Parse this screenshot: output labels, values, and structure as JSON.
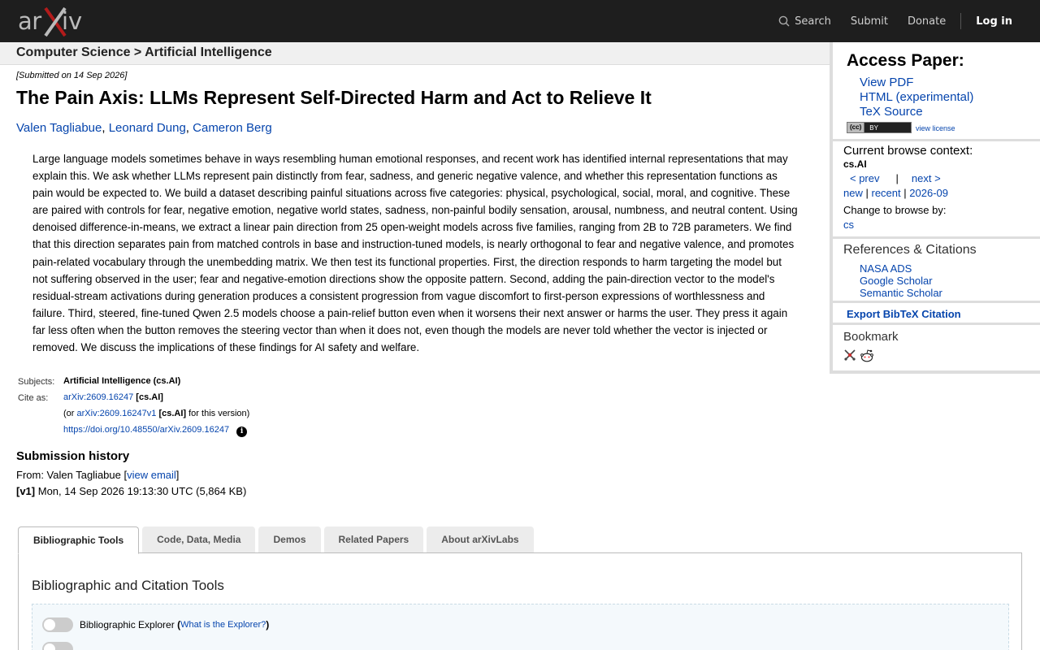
{
  "header": {
    "logo_text": "arXiv",
    "nav": {
      "search": "Search",
      "submit": "Submit",
      "donate": "Donate",
      "login": "Log in"
    }
  },
  "breadcrumb": "Computer Science > Artificial Intelligence",
  "paper": {
    "submitted": "[Submitted on 14 Sep 2026]",
    "title": "The Pain Axis: LLMs Represent Self-Directed Harm and Act to Relieve It",
    "authors": [
      "Valen Tagliabue",
      "Leonard Dung",
      "Cameron Berg"
    ],
    "abstract": "Large language models sometimes behave in ways resembling human emotional responses, and recent work has identified internal representations that may explain this. We ask whether LLMs represent pain distinctly from fear, sadness, and generic negative valence, and whether this representation functions as pain would be expected to. We build a dataset describing painful situations across five categories: physical, psychological, social, moral, and cognitive. These are paired with controls for fear, negative emotion, negative world states, sadness, non-painful bodily sensation, arousal, numbness, and neutral content. Using denoised difference-in-means, we extract a linear pain direction from 25 open-weight models across five families, ranging from 2B to 72B parameters. We find that this direction separates pain from matched controls in base and instruction-tuned models, is nearly orthogonal to fear and negative valence, and promotes pain-related vocabulary through the unembedding matrix. We then test its functional properties. First, the direction responds to harm targeting the model but not suffering observed in the user; fear and negative-emotion directions show the opposite pattern. Second, adding the pain-direction vector to the model's residual-stream activations during generation produces a consistent progression from vague discomfort to first-person expressions of worthlessness and failure. Third, steered, fine-tuned Qwen 2.5 models choose a pain-relief button even when it worsens their next answer or harms the user. They press it again far less often when the button removes the steering vector than when it does not, even though the models are never told whether the vector is injected or removed. We discuss the implications of these findings for AI safety and welfare.",
    "subjects_label": "Subjects:",
    "subjects": "Artificial Intelligence (cs.AI)",
    "cite_label": "Cite as:",
    "cite_id": "arXiv:2609.16247",
    "cite_cat": "[cs.AI]",
    "version_prefix": "(or",
    "version_id": "arXiv:2609.16247v1",
    "version_cat": "[cs.AI]",
    "version_suffix": "for this version)",
    "doi": "https://doi.org/10.48550/arXiv.2609.16247",
    "info_glyph": "i"
  },
  "history": {
    "heading": "Submission history",
    "from_prefix": "From: Valen Tagliabue [",
    "from_link": "view email",
    "from_suffix": "]",
    "v1_label": "[v1]",
    "v1_text": " Mon, 14 Sep 2026 19:13:30 UTC (5,864 KB)"
  },
  "tabs": [
    "Bibliographic Tools",
    "Code, Data, Media",
    "Demos",
    "Related Papers",
    "About arXivLabs"
  ],
  "panel": {
    "heading": "Bibliographic and Citation Tools",
    "explorer_label": "Bibliographic Explorer",
    "explorer_open": "(",
    "explorer_link": "What is the Explorer?",
    "explorer_close": ")"
  },
  "sidebar": {
    "access_heading": "Access Paper:",
    "access_links": [
      "View PDF",
      "HTML (experimental)",
      "TeX Source"
    ],
    "license_badge_cc": "(cc)",
    "license_badge_by": "BY",
    "view_license": "view license",
    "context_heading": "Current browse context:",
    "context_code": "cs.AI",
    "prev": "< prev",
    "pipe": "|",
    "next": "next >",
    "list_new": "new",
    "list_recent": "recent",
    "list_month": "2026-09",
    "change_label": "Change to browse by:",
    "change_cs": "cs",
    "refs_heading": "References & Citations",
    "refs": [
      "NASA ADS",
      "Google Scholar",
      "Semantic Scholar"
    ],
    "export": "Export BibTeX Citation",
    "bookmark_heading": "Bookmark"
  },
  "colors": {
    "topbar": "#1e1e1e",
    "link": "#0645ad",
    "logo_red": "#b31b1b"
  }
}
